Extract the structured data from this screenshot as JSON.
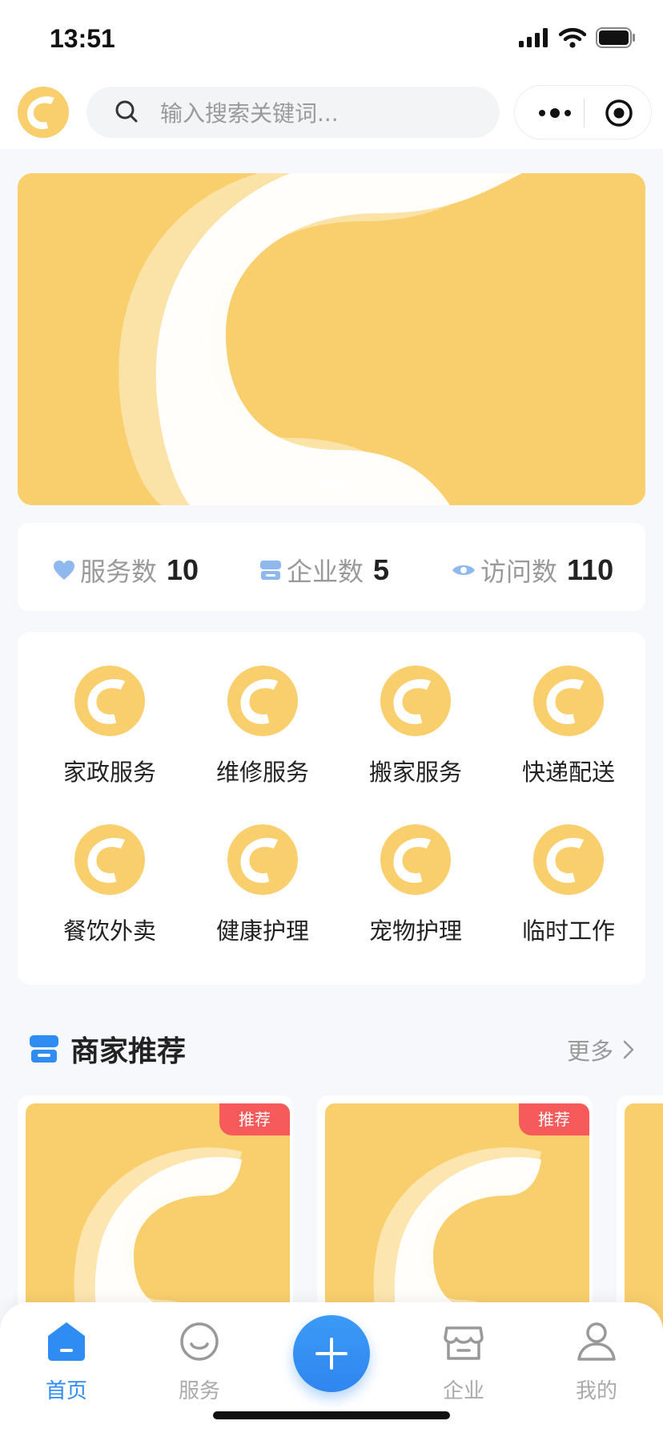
{
  "status_bar": {
    "time": "13:51"
  },
  "search": {
    "placeholder": "输入搜索关键词..."
  },
  "colors": {
    "brand_yellow": "#f9cf6d",
    "accent_blue": "#2f8cf3",
    "tag_red": "#f65a5a"
  },
  "stats": [
    {
      "icon": "heart-icon",
      "label": "服务数",
      "value": "10"
    },
    {
      "icon": "store-icon",
      "label": "企业数",
      "value": "5"
    },
    {
      "icon": "eye-icon",
      "label": "访问数",
      "value": "110"
    }
  ],
  "categories": [
    {
      "label": "家政服务"
    },
    {
      "label": "维修服务"
    },
    {
      "label": "搬家服务"
    },
    {
      "label": "快递配送"
    },
    {
      "label": "餐饮外卖"
    },
    {
      "label": "健康护理"
    },
    {
      "label": "宠物护理"
    },
    {
      "label": "临时工作"
    }
  ],
  "merchants": {
    "title": "商家推荐",
    "more": "更多",
    "cards": [
      {
        "tag": "推荐"
      },
      {
        "tag": "推荐"
      }
    ]
  },
  "tabbar": [
    {
      "label": "首页",
      "icon": "home-icon",
      "active": true
    },
    {
      "label": "服务",
      "icon": "smile-icon",
      "active": false
    },
    {
      "label": "企业",
      "icon": "store-icon",
      "active": false
    },
    {
      "label": "我的",
      "icon": "user-icon",
      "active": false
    }
  ]
}
